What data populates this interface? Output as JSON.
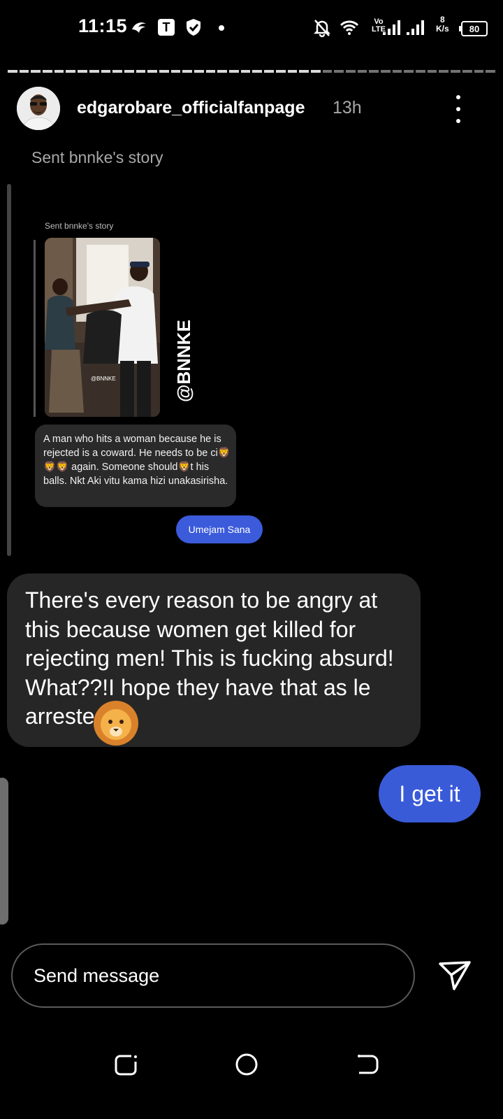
{
  "status_bar": {
    "time": "11:15",
    "volte_top": "Vo",
    "volte_bottom": "LTE",
    "net_speed_value": "8",
    "net_speed_unit": "K/s",
    "battery": "80"
  },
  "header": {
    "username": "edgarobare_officialfanpage",
    "time_ago": "13h"
  },
  "story": {
    "sent_label": "Sent bnnke's story",
    "embed": {
      "sent_label": "Sent bnnke's story",
      "watermark_small": "@BNNKE",
      "watermark_large": "@BNNKE",
      "message": "A man who hits a woman because he is rejected is a coward. He needs to be ci🦁🦁🦁 again. Someone should🦁t his balls. Nkt Aki vitu kama hizi unakasirisha.",
      "reply": "Umejam Sana"
    }
  },
  "messages": {
    "incoming": "There's every reason to be angry at this because women get killed for rejecting men! This is fucking absurd! What??!I hope they have that as      le arrested",
    "outgoing": "I get it"
  },
  "composer": {
    "placeholder": "Send message"
  },
  "colors": {
    "outgoing_bubble": "#3a5bd8",
    "incoming_bubble": "#262626",
    "background": "#000000"
  },
  "icons": [
    "signal-app-icon",
    "t-icon",
    "shield-icon",
    "mute-bell-icon",
    "wifi-icon",
    "send-icon",
    "recents-icon",
    "home-icon",
    "back-icon"
  ]
}
